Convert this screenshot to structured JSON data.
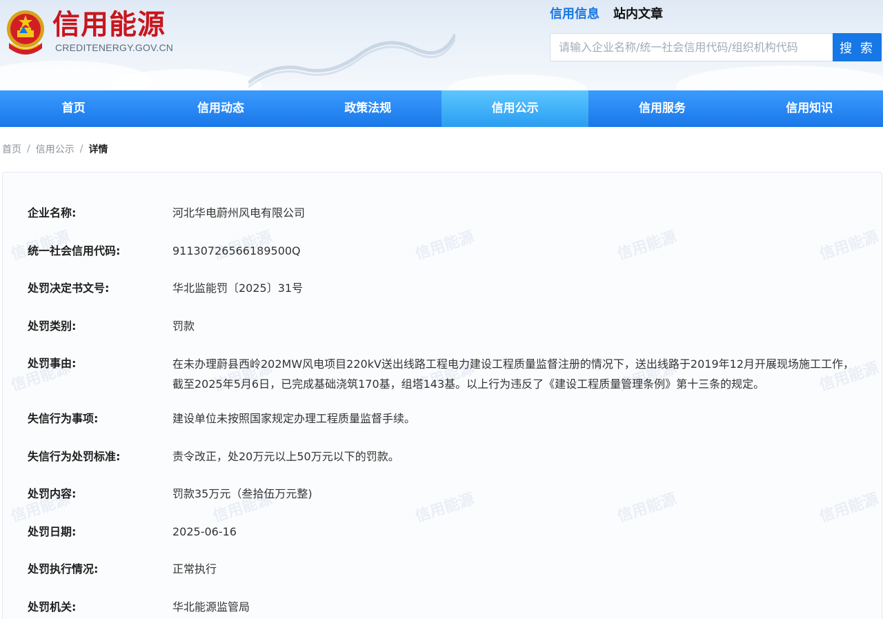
{
  "site": {
    "brand_name": "信用能源",
    "domain": "CREDITENERGY.GOV.CN"
  },
  "search": {
    "tabs": [
      "信用信息",
      "站内文章"
    ],
    "active_tab": "信用信息",
    "placeholder": "请输入企业名称/统一社会信用代码/组织机构代码",
    "button_label": "搜 索"
  },
  "nav": {
    "items": [
      "首页",
      "信用动态",
      "政策法规",
      "信用公示",
      "信用服务",
      "信用知识"
    ],
    "active": "信用公示"
  },
  "breadcrumb": {
    "items": [
      "首页",
      "信用公示",
      "详情"
    ],
    "separator": "/"
  },
  "watermark_text": "信用能源",
  "detail": {
    "fields": [
      {
        "label": "企业名称:",
        "value": "河北华电蔚州风电有限公司"
      },
      {
        "label": "统一社会信用代码:",
        "value": "91130726566189500Q"
      },
      {
        "label": "处罚决定书文号:",
        "value": "华北监能罚〔2025〕31号"
      },
      {
        "label": "处罚类别:",
        "value": "罚款"
      },
      {
        "label": "处罚事由:",
        "value": "在未办理蔚县西岭202MW风电项目220kV送出线路工程电力建设工程质量监督注册的情况下，送出线路于2019年12月开展现场施工工作，截至2025年5月6日，已完成基础浇筑170基，组塔143基。以上行为违反了《建设工程质量管理条例》第十三条的规定。"
      },
      {
        "label": "失信行为事项:",
        "value": "建设单位未按照国家规定办理工程质量监督手续。"
      },
      {
        "label": "失信行为处罚标准:",
        "value": "责令改正，处20万元以上50万元以下的罚款。"
      },
      {
        "label": "处罚内容:",
        "value": "罚款35万元（叁拾伍万元整)"
      },
      {
        "label": "处罚日期:",
        "value": "2025-06-16"
      },
      {
        "label": "处罚执行情况:",
        "value": "正常执行"
      },
      {
        "label": "处罚机关:",
        "value": "华北能源监管局"
      }
    ]
  },
  "colors": {
    "brand_red": "#c8161d",
    "primary_blue": "#1677e6",
    "nav_active": "#2a9df2"
  }
}
